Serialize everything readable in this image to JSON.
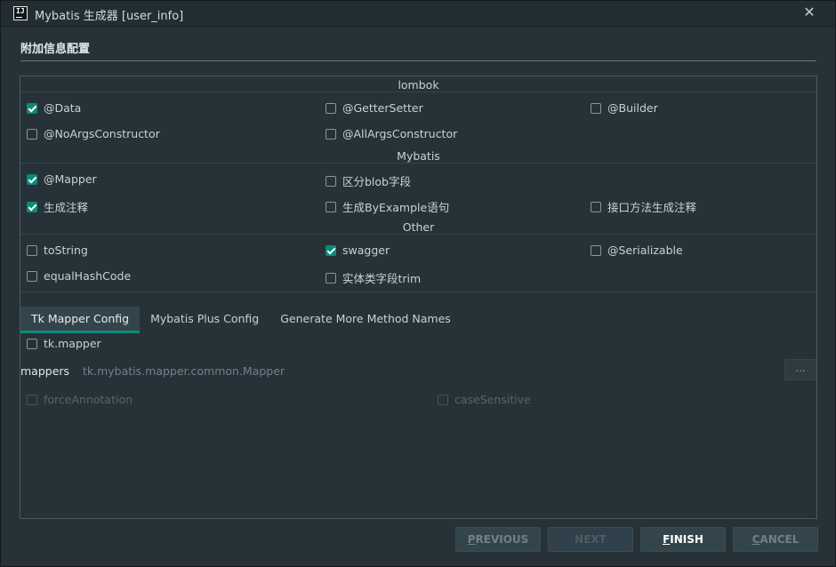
{
  "window": {
    "title": "Mybatis 生成器 [user_info]",
    "icon_text": "IJ"
  },
  "section": {
    "title": "附加信息配置"
  },
  "groups": {
    "lombok": {
      "title": "lombok",
      "options": [
        {
          "label": "@Data",
          "checked": true
        },
        {
          "label": "@GetterSetter",
          "checked": false
        },
        {
          "label": "@Builder",
          "checked": false
        },
        {
          "label": "@NoArgsConstructor",
          "checked": false
        },
        {
          "label": "@AllArgsConstructor",
          "checked": false
        }
      ]
    },
    "mybatis": {
      "title": "Mybatis",
      "options": [
        {
          "label": "@Mapper",
          "checked": true
        },
        {
          "label": "区分blob字段",
          "checked": false
        },
        {
          "label": "生成注释",
          "checked": true
        },
        {
          "label": "生成ByExample语句",
          "checked": false
        },
        {
          "label": "接口方法生成注释",
          "checked": false
        }
      ]
    },
    "other": {
      "title": "Other",
      "options": [
        {
          "label": "toString",
          "checked": false
        },
        {
          "label": "swagger",
          "checked": true
        },
        {
          "label": "@Serializable",
          "checked": false
        },
        {
          "label": "equalHashCode",
          "checked": false
        },
        {
          "label": "实体类字段trim",
          "checked": false
        }
      ]
    }
  },
  "tabs": [
    {
      "label": "Tk Mapper Config",
      "active": true
    },
    {
      "label": "Mybatis Plus Config",
      "active": false
    },
    {
      "label": "Generate More Method Names",
      "active": false
    }
  ],
  "tk_config": {
    "tk_mapper": {
      "label": "tk.mapper",
      "checked": false
    },
    "mappers_label": "mappers",
    "mappers_value": "tk.mybatis.mapper.common.Mapper",
    "browse_label": "...",
    "force_annotation": {
      "label": "forceAnnotation",
      "checked": false,
      "disabled": true
    },
    "case_sensitive": {
      "label": "caseSensitive",
      "checked": false,
      "disabled": true
    }
  },
  "buttons": {
    "previous": {
      "first": "P",
      "rest": "REVIOUS"
    },
    "next": "NEXT",
    "finish": {
      "first": "F",
      "rest": "INISH"
    },
    "cancel": {
      "first": "C",
      "rest": "ANCEL"
    }
  },
  "colors": {
    "accent": "#0b8a7a",
    "background": "#263238",
    "titlebar": "#222e34"
  }
}
